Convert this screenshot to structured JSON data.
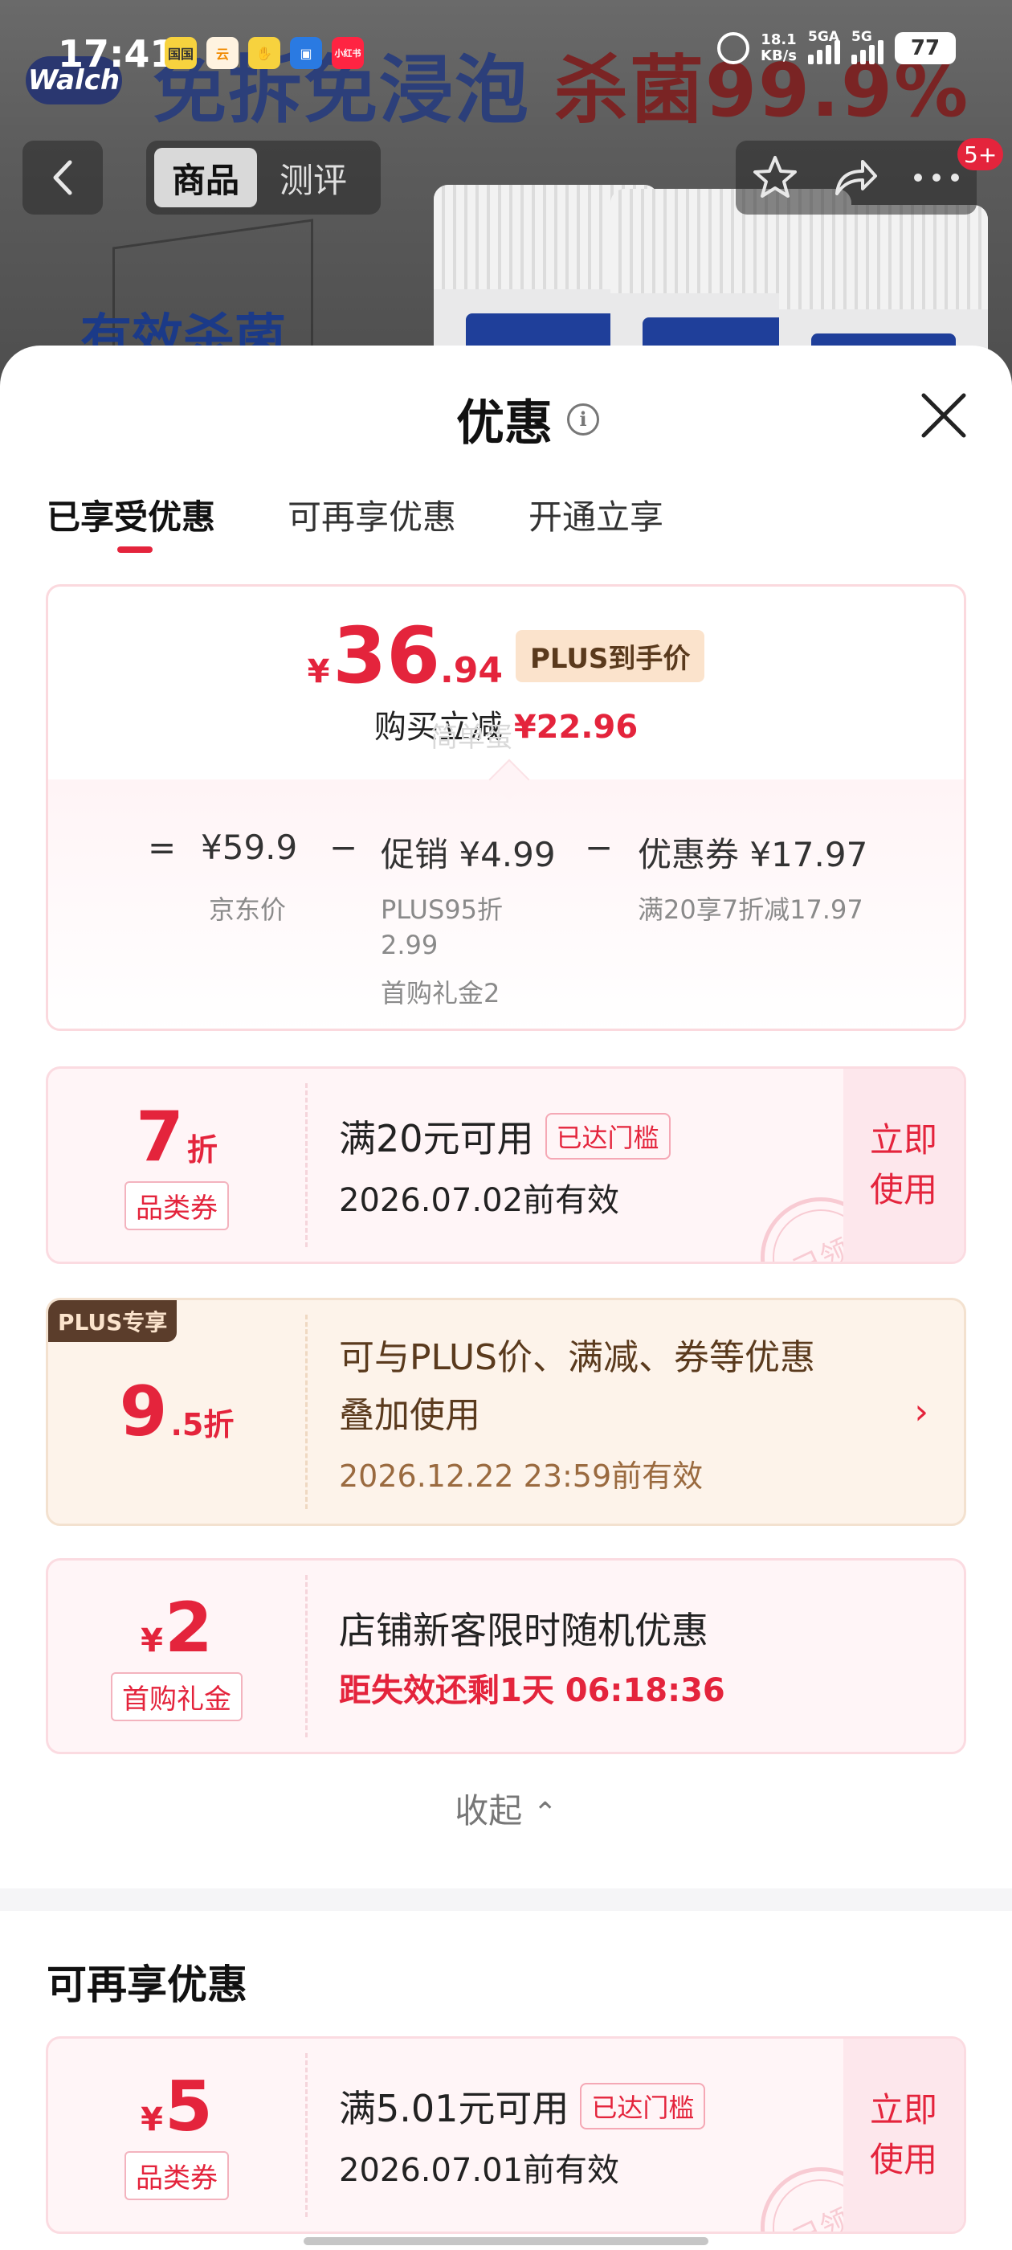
{
  "status_bar": {
    "time": "17:41",
    "apps": [
      {
        "icon": "app-icon-1",
        "text": "国国",
        "color": "#f7d23e"
      },
      {
        "icon": "app-icon-2",
        "text": "云",
        "color": "#fff3e0"
      },
      {
        "icon": "app-icon-3",
        "text": "✋",
        "color": "#f7d23e"
      },
      {
        "icon": "app-icon-4",
        "text": "▣",
        "color": "#2a7ae2"
      },
      {
        "icon": "app-icon-5",
        "text": "小红书",
        "color": "#ff2442"
      }
    ],
    "net_speed_value": "18.1",
    "net_speed_unit": "KB/s",
    "sim1_label": "5GA",
    "sim2_label": "5G",
    "battery": "77"
  },
  "background": {
    "logo": "Walch",
    "banner_left": "免拆免浸泡",
    "banner_right": "杀菌99.9%",
    "effect_text": "有效杀菌"
  },
  "nav": {
    "tabs": [
      "商品",
      "测评"
    ],
    "active_tab": 0,
    "badge": "5+"
  },
  "sheet": {
    "title": "优惠",
    "tabs": [
      "已享受优惠",
      "可再享优惠",
      "开通立享"
    ],
    "active_tab": 0
  },
  "price_summary": {
    "currency": "¥",
    "price_int": "36",
    "price_dec": ".94",
    "plus_tag": "PLUS到手价",
    "reduce_label": "购买立减",
    "reduce_amount": "¥22.96",
    "eq": "=",
    "minus": "−",
    "jd_price": "¥59.9",
    "jd_price_label": "京东价",
    "promo": "促销 ¥4.99",
    "promo_detail_1a": "PLUS95折",
    "promo_detail_1b": "2.99",
    "promo_detail_2": "首购礼金2",
    "coupon": "优惠券 ¥17.97",
    "coupon_detail": "满20享7折减17.97"
  },
  "coupons": [
    {
      "big": "7",
      "unit": "折",
      "tag": "品类券",
      "line1": "满20元可用",
      "reached": "已达门槛",
      "line2": "2026.07.02前有效",
      "action": "立即使用",
      "stamp": "已领"
    },
    {
      "badge": "PLUS专享",
      "big": "9",
      "unit": ".5折",
      "line1a": "可与PLUS价、满减、券等优惠",
      "line1b": "叠加使用",
      "line2": "2026.12.22 23:59前有效",
      "arrow": "›"
    },
    {
      "yen": "¥",
      "big": "2",
      "tag": "首购礼金",
      "line1": "店铺新客限时随机优惠",
      "countdown": "距失效还剩1天 06:18:36"
    }
  ],
  "collapse_label": "收起",
  "collapse_arrow": "⌃",
  "more_section": {
    "title": "可再享优惠",
    "coupon": {
      "yen": "¥",
      "big": "5",
      "tag": "品类券",
      "line1": "满5.01元可用",
      "reached": "已达门槛",
      "line2": "2026.07.01前有效",
      "action": "立即使用",
      "stamp": "已领"
    }
  },
  "watermark": "简单蛋",
  "colors": {
    "accent": "#e4243c",
    "plus_gold": "#fbe3cc",
    "plus_brown": "#5b3d2b"
  }
}
